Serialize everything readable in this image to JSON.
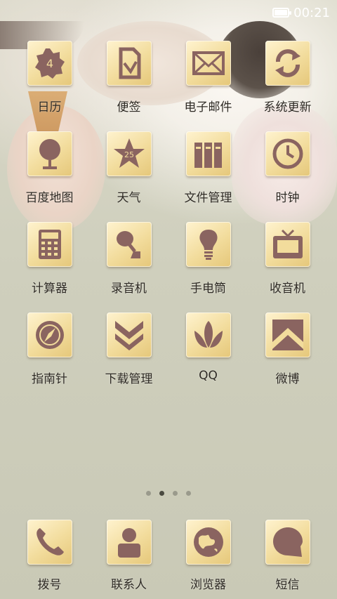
{
  "status_bar": {
    "time": "00:21",
    "battery_icon": "battery-icon"
  },
  "colors": {
    "icon_glyph": "#8a6460",
    "tile": "#f2dc9c"
  },
  "apps": [
    {
      "label": "日历",
      "icon": "calendar-icon"
    },
    {
      "label": "便签",
      "icon": "notes-icon"
    },
    {
      "label": "电子邮件",
      "icon": "email-icon"
    },
    {
      "label": "系统更新",
      "icon": "update-icon"
    },
    {
      "label": "百度地图",
      "icon": "map-icon"
    },
    {
      "label": "天气",
      "icon": "weather-icon",
      "badge": "25"
    },
    {
      "label": "文件管理",
      "icon": "file-manager-icon"
    },
    {
      "label": "时钟",
      "icon": "clock-icon"
    },
    {
      "label": "计算器",
      "icon": "calculator-icon"
    },
    {
      "label": "录音机",
      "icon": "recorder-icon"
    },
    {
      "label": "手电筒",
      "icon": "flashlight-icon"
    },
    {
      "label": "收音机",
      "icon": "radio-icon"
    },
    {
      "label": "指南针",
      "icon": "compass-icon"
    },
    {
      "label": "下载管理",
      "icon": "download-icon"
    },
    {
      "label": "QQ",
      "icon": "qq-icon"
    },
    {
      "label": "微博",
      "icon": "weibo-icon"
    }
  ],
  "calendar_day": "4",
  "page_indicator": {
    "count": 4,
    "active": 1
  },
  "dock": [
    {
      "label": "拨号",
      "icon": "phone-icon"
    },
    {
      "label": "联系人",
      "icon": "contacts-icon"
    },
    {
      "label": "浏览器",
      "icon": "browser-icon"
    },
    {
      "label": "短信",
      "icon": "messages-icon"
    }
  ]
}
